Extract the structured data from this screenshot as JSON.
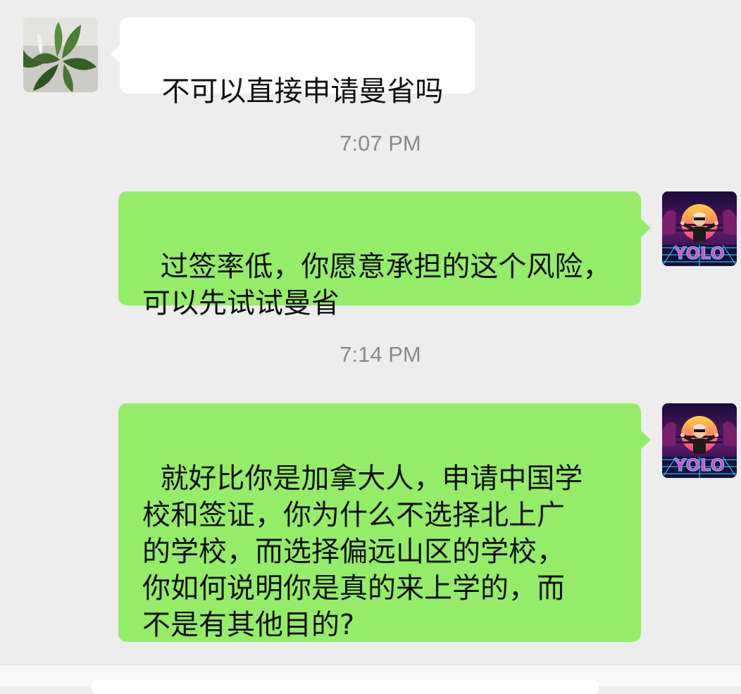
{
  "messages": [
    {
      "direction": "incoming",
      "avatar": "plant-photo-avatar",
      "text": "不可以直接申请曼省吗"
    },
    {
      "timestamp": "7:07 PM"
    },
    {
      "direction": "outgoing",
      "avatar": "yolo-synthwave-avatar",
      "text": "过签率低，你愿意承担的这个风险，\n可以先试试曼省"
    },
    {
      "timestamp": "7:14 PM"
    },
    {
      "direction": "outgoing",
      "avatar": "yolo-synthwave-avatar",
      "text": "就好比你是加拿大人，申请中国学\n校和签证，你为什么不选择北上广\n的学校，而选择偏远山区的学校，\n你如何说明你是真的来上学的，而\n不是有其他目的?"
    }
  ],
  "avatar_logo_text": "YOLO",
  "colors": {
    "background": "#ededed",
    "incoming_bubble": "#ffffff",
    "outgoing_bubble": "#95ec69",
    "timestamp_text": "#8a8a8a"
  }
}
